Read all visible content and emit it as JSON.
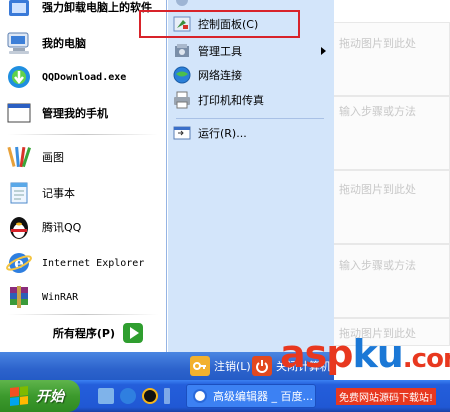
{
  "background": {
    "hints": [
      {
        "text": "拖动图片到此处"
      },
      {
        "text": "输入步骤或方法"
      },
      {
        "text": "拖动图片到此处"
      },
      {
        "text": "输入步骤或方法"
      },
      {
        "text": "拖动图片到此处"
      },
      {
        "text": "拖动图片到此处"
      }
    ]
  },
  "start_menu": {
    "left_items": [
      {
        "label": "强力卸载电脑上的软件",
        "icon": "uninstall-icon"
      },
      {
        "label": "我的电脑",
        "icon": "my-computer-icon"
      },
      {
        "label": "QQDownload.exe",
        "icon": "qqdownload-icon"
      },
      {
        "label": "管理我的手机",
        "icon": "phone-manager-icon"
      },
      {
        "label": "画图",
        "icon": "paint-icon"
      },
      {
        "label": "记事本",
        "icon": "notepad-icon"
      },
      {
        "label": "腾讯QQ",
        "icon": "qq-penguin-icon"
      },
      {
        "label": "Internet Explorer",
        "icon": "internet-explorer-icon"
      },
      {
        "label": "WinRAR",
        "icon": "winrar-icon"
      }
    ],
    "all_programs": "所有程序(P)",
    "right_items": [
      {
        "label": "控制面板(C)",
        "icon": "control-panel-icon"
      },
      {
        "label": "管理工具",
        "icon": "admin-tools-icon"
      },
      {
        "label": "网络连接",
        "icon": "network-connections-icon"
      },
      {
        "label": "打印机和传真",
        "icon": "printer-fax-icon"
      },
      {
        "label": "运行(R)...",
        "icon": "run-icon"
      }
    ],
    "logoff_label": "注销(L)",
    "shutdown_label": "关闭计算机(U)"
  },
  "taskbar": {
    "start_label": "开始",
    "quick_launch": [
      "show-desktop-icon",
      "ie-icon",
      "qq-icon"
    ],
    "active_window": "高级编辑器 _ 百度..."
  },
  "watermark": {
    "logo_part1": "asp",
    "logo_part2": "ku",
    "logo_part3": ".com",
    "tagline": "免费网站源码下载站!"
  },
  "colors": {
    "highlight": "#d8232a",
    "taskbar": "#245edb",
    "start_button": "#3c9a2d",
    "menu_right_pane": "#d3e5fa"
  }
}
